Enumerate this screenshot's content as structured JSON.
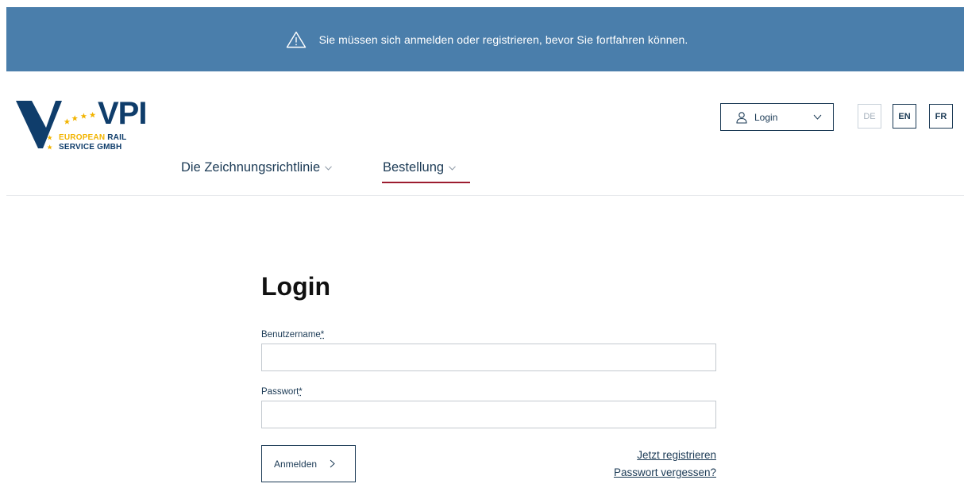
{
  "alert": {
    "message": "Sie müssen sich anmelden oder registrieren, bevor Sie fortfahren können.",
    "icon": "warning-triangle-icon"
  },
  "logo": {
    "brand": "VPI",
    "line1_part1": "EUROPEAN",
    "line1_part2": "RAIL",
    "line2": "SERVICE GMBH"
  },
  "header": {
    "login_button_label": "Login",
    "languages": [
      "DE",
      "EN",
      "FR"
    ],
    "nav": [
      {
        "label": "Die Zeichnungsrichtlinie"
      },
      {
        "label": "Bestellung"
      }
    ]
  },
  "form": {
    "title": "Login",
    "username_label": "Benutzername",
    "password_label": "Passwort",
    "required_marker": "*",
    "username_value": "",
    "password_value": "",
    "submit_label": "Anmelden",
    "register_link": "Jetzt registrieren",
    "forgot_link": "Passwort vergessen?"
  },
  "colors": {
    "alert_bg": "#4a7eab",
    "brand_blue": "#0f3d6b",
    "accent_red": "#9c1c2f",
    "star_yellow": "#f2b400"
  }
}
